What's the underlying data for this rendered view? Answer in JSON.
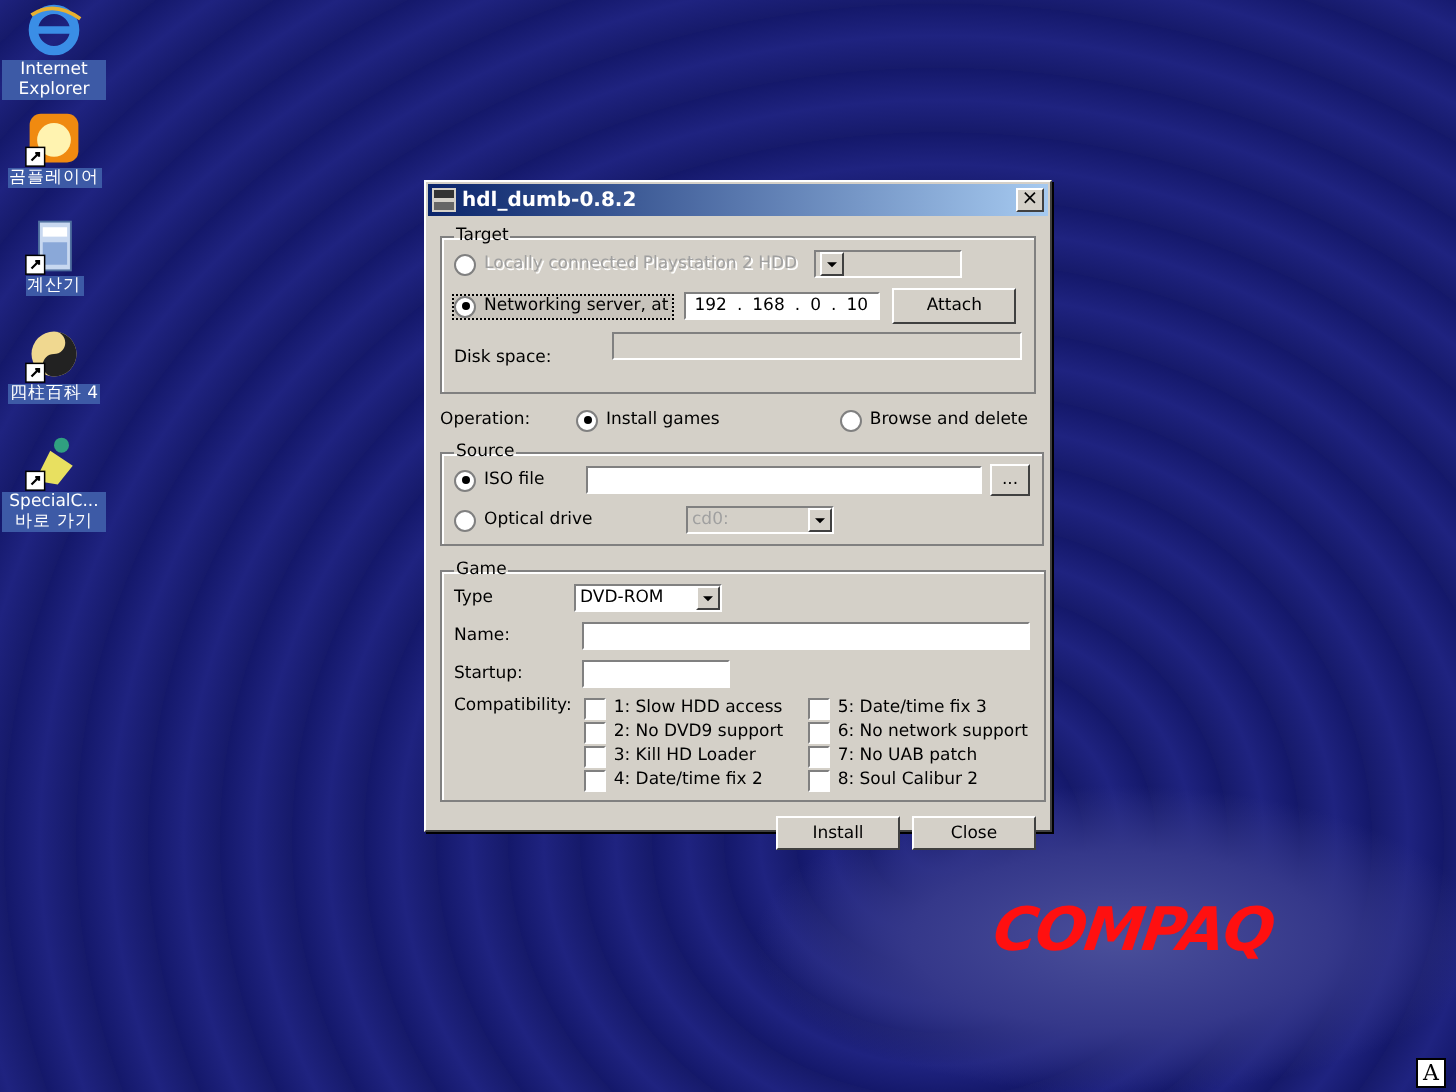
{
  "desktop_icons": [
    {
      "label": "Internet Explorer",
      "kind": "browser",
      "shortcut": false
    },
    {
      "label": "곰플레이어",
      "kind": "player",
      "shortcut": true
    },
    {
      "label": "계산기",
      "kind": "calculator",
      "shortcut": true
    },
    {
      "label": "四柱百科 4",
      "kind": "yinyang",
      "shortcut": true
    },
    {
      "label": "SpecialC... 바로 가기",
      "kind": "pin",
      "shortcut": true
    }
  ],
  "window": {
    "title": "hdl_dumb-0.8.2",
    "close": "×"
  },
  "target": {
    "legend": "Target",
    "options": [
      {
        "label": "Locally connected Playstation 2 HDD",
        "selected": false,
        "disabled": true
      },
      {
        "label": "Networking server, at",
        "selected": true,
        "disabled": false
      }
    ],
    "ip": [
      "192",
      "168",
      "0",
      "10"
    ],
    "ip_separator": ".",
    "attach": "Attach",
    "disk_space_label": "Disk space:"
  },
  "operation": {
    "label": "Operation:",
    "options": [
      {
        "label": "Install games",
        "selected": true
      },
      {
        "label": "Browse and delete",
        "selected": false
      }
    ]
  },
  "source": {
    "legend": "Source",
    "options": [
      {
        "label": "ISO file",
        "selected": true
      },
      {
        "label": "Optical drive",
        "selected": false
      }
    ],
    "browse": "...",
    "drive": "cd0:"
  },
  "game": {
    "legend": "Game",
    "type_label": "Type",
    "type_value": "DVD-ROM",
    "name_label": "Name:",
    "startup_label": "Startup:",
    "compat_label": "Compatibility:",
    "compat": [
      {
        "label": "1: Slow HDD access",
        "checked": false
      },
      {
        "label": "2: No DVD9 support",
        "checked": false
      },
      {
        "label": "3: Kill HD Loader",
        "checked": false
      },
      {
        "label": "4: Date/time fix 2",
        "checked": false
      },
      {
        "label": "5: Date/time fix 3",
        "checked": false
      },
      {
        "label": "6: No network support",
        "checked": false
      },
      {
        "label": "7: No UAB patch",
        "checked": false
      },
      {
        "label": "8: Soul Calibur 2",
        "checked": false
      }
    ]
  },
  "buttons": [
    "Install",
    "Close"
  ],
  "logo": "COMPAQ",
  "ime": "A"
}
